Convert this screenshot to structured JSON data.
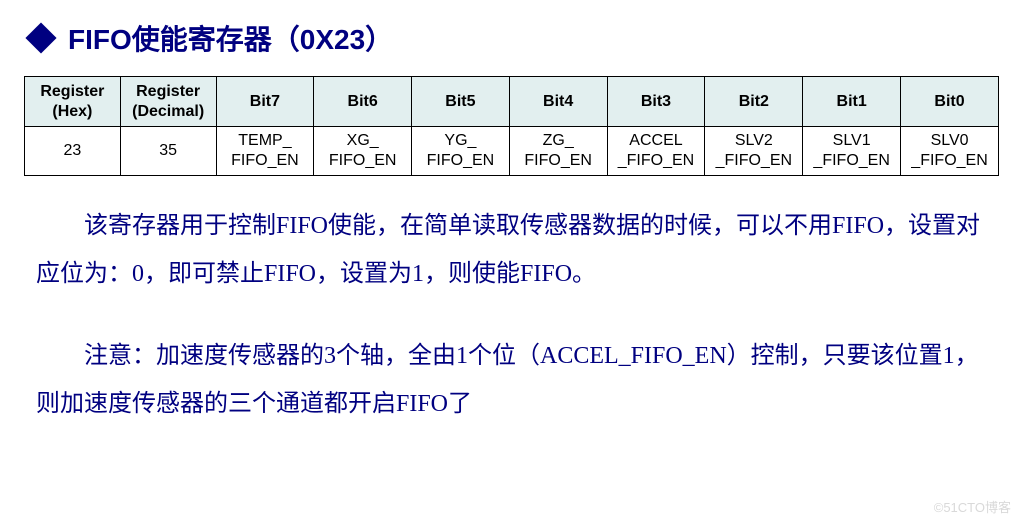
{
  "heading": {
    "title": "FIFO使能寄存器（0X23）"
  },
  "table": {
    "headers": {
      "hex": "Register (Hex)",
      "dec": "Register (Decimal)",
      "bit7": "Bit7",
      "bit6": "Bit6",
      "bit5": "Bit5",
      "bit4": "Bit4",
      "bit3": "Bit3",
      "bit2": "Bit2",
      "bit1": "Bit1",
      "bit0": "Bit0"
    },
    "row": {
      "hex": "23",
      "dec": "35",
      "bit7": "TEMP_ FIFO_EN",
      "bit6": "XG_ FIFO_EN",
      "bit5": "YG_ FIFO_EN",
      "bit4": "ZG_ FIFO_EN",
      "bit3": "ACCEL _FIFO_EN",
      "bit2": "SLV2 _FIFO_EN",
      "bit1": "SLV1 _FIFO_EN",
      "bit0": "SLV0 _FIFO_EN"
    }
  },
  "paragraphs": {
    "p1": "该寄存器用于控制FIFO使能，在简单读取传感器数据的时候，可以不用FIFO，设置对应位为：0，即可禁止FIFO，设置为1，则使能FIFO。",
    "p2": "注意：加速度传感器的3个轴，全由1个位（ACCEL_FIFO_EN）控制，只要该位置1，则加速度传感器的三个通道都开启FIFO了"
  },
  "watermark": "©51CTO博客"
}
